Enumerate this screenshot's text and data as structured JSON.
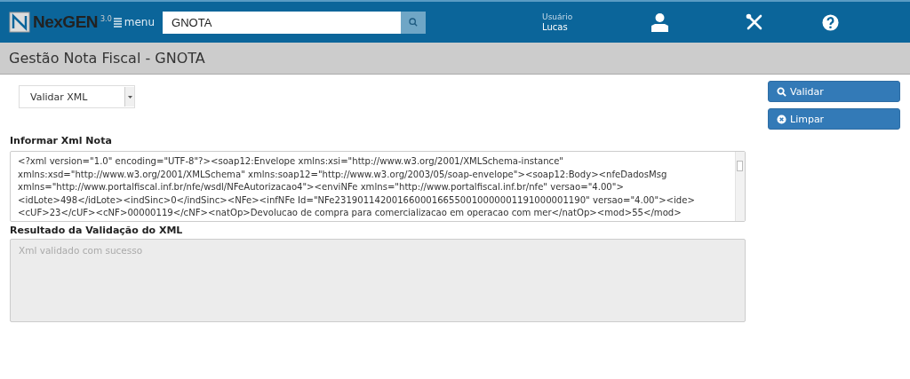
{
  "header": {
    "logo": {
      "name": "NexGEN",
      "version": "3.0"
    },
    "menu_label": "menu",
    "search": {
      "value": "GNOTA"
    },
    "user": {
      "label": "Usuário",
      "name": "Lucas"
    }
  },
  "page_title": "Gestão Nota Fiscal - GNOTA",
  "action_select": {
    "value": "Validar XML"
  },
  "buttons": [
    {
      "kind": "search",
      "label": "Validar"
    },
    {
      "kind": "clear",
      "label": "Limpar"
    }
  ],
  "xml_input": {
    "label": "Informar Xml Nota",
    "lines": [
      "<?xml version=\"1.0\" encoding=\"UTF-8\"?><soap12:Envelope xmlns:xsi=\"http://www.w3.org/2001/XMLSchema-instance\"",
      "xmlns:xsd=\"http://www.w3.org/2001/XMLSchema\" xmlns:soap12=\"http://www.w3.org/2003/05/soap-envelope\"><soap12:Body><nfeDadosMsg",
      "xmlns=\"http://www.portalfiscal.inf.br/nfe/wsdl/NFeAutorizacao4\"><enviNFe xmlns=\"http://www.portalfiscal.inf.br/nfe\" versao=\"4.00\">",
      "<idLote>498</idLote><indSinc>0</indSinc><NFe><infNFe Id=\"NFe23190114200166000166550010000001191000001190\" versao=\"4.00\"><ide>",
      "<cUF>23</cUF><cNF>00000119</cNF><natOp>Devolucao de compra para comercializacao em operacao com mer</natOp><mod>55</mod>"
    ]
  },
  "result": {
    "label": "Resultado da Validação do XML",
    "placeholder": "Xml validado com sucesso",
    "disabled": true
  }
}
